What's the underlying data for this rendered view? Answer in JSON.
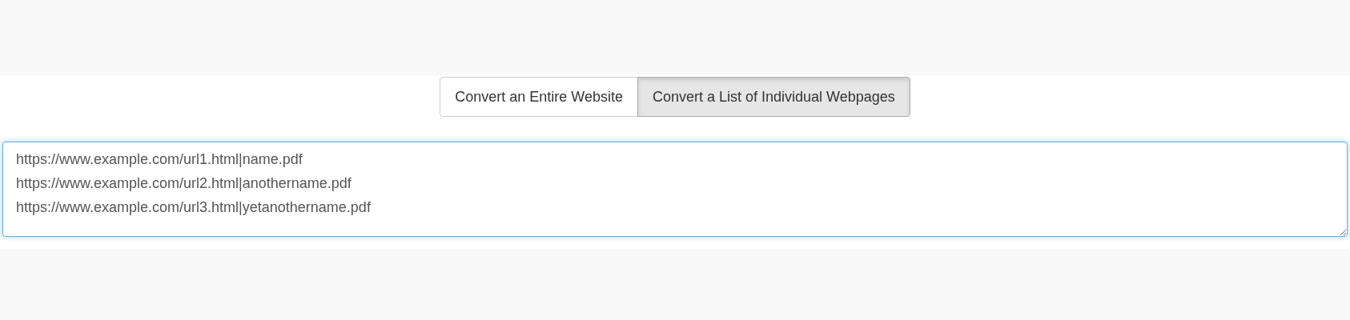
{
  "mode_toggle": [
    {
      "label": "Convert an Entire Website",
      "selected": false
    },
    {
      "label": "Convert a List of Individual Webpages",
      "selected": true
    }
  ],
  "url_list": {
    "value": "https://www.example.com/url1.html|name.pdf\nhttps://www.example.com/url2.html|anothername.pdf\nhttps://www.example.com/url3.html|yetanothername.pdf"
  }
}
